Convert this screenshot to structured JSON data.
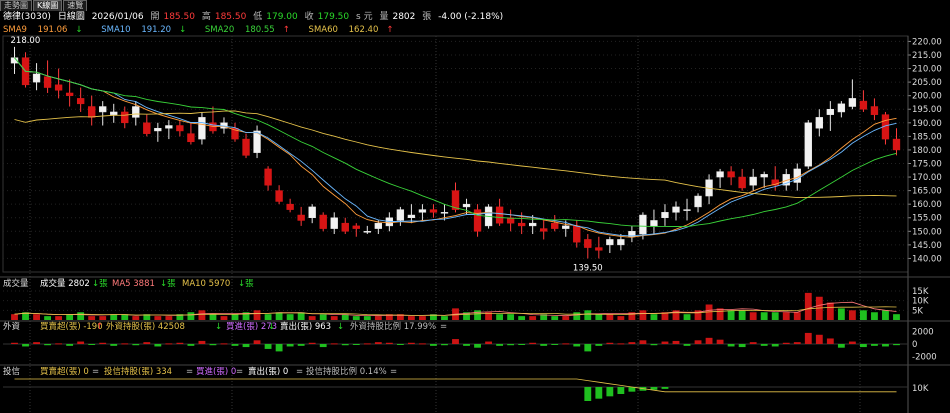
{
  "tabs": [
    "走勢圖",
    "K線圖",
    "速覽"
  ],
  "active_tab": 1,
  "header": {
    "stock": "德律(3030)",
    "period": "日線圖",
    "date": "2026/01/06",
    "open_label": "開",
    "open": "185.50",
    "high_label": "高",
    "high": "185.50",
    "low_label": "低",
    "low": "179.00",
    "close_label": "收",
    "close": "179.50",
    "unit": "s 元",
    "volume_label": "量",
    "volume": "2802",
    "volume_unit": "張",
    "change": "-4.00 (-2.18%)"
  },
  "sma": [
    {
      "label": "SMA9",
      "value": "191.06",
      "arrow": "↓",
      "color": "#ff9e3d"
    },
    {
      "label": "SMA10",
      "value": "191.20",
      "arrow": "↓",
      "color": "#6ab8ff"
    },
    {
      "label": "SMA20",
      "value": "180.55",
      "arrow": "↑",
      "color": "#39d339"
    },
    {
      "label": "SMA60",
      "value": "162.40",
      "arrow": "↑",
      "color": "#e5c24a"
    }
  ],
  "price_axis": {
    "ticks": [
      "220.00",
      "215.00",
      "210.00",
      "205.00",
      "200.00",
      "195.00",
      "190.00",
      "185.00",
      "180.00",
      "175.00",
      "170.00",
      "165.00",
      "160.00",
      "155.00",
      "150.00",
      "145.00",
      "140.00"
    ],
    "high_mark": "218.00",
    "low_mark": "139.50"
  },
  "volume_panel": {
    "title": "成交量",
    "label": "成交量",
    "value": "2802",
    "arrow": "↓",
    "unit": "張",
    "ma5_label": "MA5",
    "ma5": "3881",
    "ma5_arrow": "↓",
    "ma5_unit": "張",
    "ma10_label": "MA10",
    "ma10": "5970",
    "ma10_arrow": "↓",
    "ma10_unit": "張",
    "axis": [
      "15K",
      "10K",
      "5K"
    ]
  },
  "foreign_panel": {
    "title": "外資",
    "net_label": "買賣超(張)",
    "net": "-190",
    "net_arrow": "↑",
    "hold_label": "外資持股(張)",
    "hold": "42508",
    "hold_arrow": "↓",
    "buy_label": "買進(張)",
    "buy": "273",
    "buy_arrow": "↓",
    "sell_label": "賣出(張)",
    "sell": "963",
    "sell_arrow": "↓",
    "ratio_label": "外資持股比例",
    "ratio": "17.99%",
    "ratio_arrow": "=",
    "axis": [
      "2000",
      "0",
      "-2000"
    ]
  },
  "trust_panel": {
    "title": "投信",
    "net_label": "買賣超(張)",
    "net": "0",
    "net_arrow": "=",
    "hold_label": "投信持股(張)",
    "hold": "334",
    "hold_arrow": "=",
    "buy_label": "買進(張)",
    "buy": "0",
    "buy_arrow": "=",
    "sell_label": "賣出(張)",
    "sell": "0",
    "sell_arrow": "=",
    "ratio_label": "投信持股比例",
    "ratio": "0.14%",
    "ratio_arrow": "=",
    "axis": [
      "10K"
    ]
  },
  "chart_data": {
    "type": "candlestick",
    "ylim": [
      135,
      222
    ],
    "candles": [
      [
        212,
        218,
        208,
        214
      ],
      [
        214,
        216,
        203,
        204
      ],
      [
        205,
        212,
        202,
        208
      ],
      [
        207,
        213,
        201,
        203
      ],
      [
        204,
        210,
        199,
        202
      ],
      [
        201,
        206,
        196,
        200
      ],
      [
        199,
        203,
        194,
        197
      ],
      [
        196,
        200,
        189,
        192
      ],
      [
        194,
        198,
        189,
        196
      ],
      [
        193,
        197,
        190,
        194
      ],
      [
        194,
        196,
        188,
        190
      ],
      [
        192,
        198,
        189,
        196
      ],
      [
        190,
        193,
        185,
        186
      ],
      [
        187,
        190,
        183,
        188
      ],
      [
        188,
        191,
        184,
        189
      ],
      [
        189,
        191,
        185,
        187
      ],
      [
        186,
        190,
        182,
        183
      ],
      [
        184,
        194,
        182,
        192
      ],
      [
        190,
        196,
        186,
        187
      ],
      [
        188,
        192,
        186,
        190
      ],
      [
        188,
        190,
        183,
        184
      ],
      [
        184,
        186,
        177,
        178
      ],
      [
        179,
        189,
        177,
        187
      ],
      [
        173,
        174,
        165,
        167
      ],
      [
        165,
        167,
        160,
        161
      ],
      [
        160,
        162,
        157,
        158
      ],
      [
        156,
        159,
        152,
        154
      ],
      [
        155,
        160,
        153,
        159
      ],
      [
        156,
        157,
        150,
        151
      ],
      [
        151,
        157,
        149,
        155
      ],
      [
        153,
        155,
        149,
        150
      ],
      [
        152,
        153,
        148,
        151
      ],
      [
        150,
        152,
        149,
        150
      ],
      [
        151,
        154,
        149,
        153
      ],
      [
        152,
        157,
        150,
        155
      ],
      [
        154,
        159,
        152,
        158
      ],
      [
        155,
        160,
        153,
        156
      ],
      [
        157,
        160,
        154,
        158
      ],
      [
        158,
        160,
        155,
        157
      ],
      [
        157,
        160,
        154,
        157
      ],
      [
        165,
        168,
        157,
        158
      ],
      [
        159,
        162,
        156,
        160
      ],
      [
        158,
        160,
        148,
        150
      ],
      [
        152,
        160,
        151,
        159
      ],
      [
        159,
        162,
        152,
        153
      ],
      [
        155,
        158,
        150,
        153
      ],
      [
        153,
        157,
        149,
        152
      ],
      [
        152,
        156,
        149,
        153
      ],
      [
        151,
        154,
        147,
        150
      ],
      [
        153,
        156,
        150,
        151
      ],
      [
        151,
        154,
        148,
        152
      ],
      [
        152,
        154,
        144,
        146
      ],
      [
        147,
        149,
        140,
        144
      ],
      [
        144,
        148,
        140,
        143
      ],
      [
        145,
        148,
        142,
        147
      ],
      [
        145,
        149,
        143,
        147
      ],
      [
        148,
        152,
        146,
        150
      ],
      [
        149,
        157,
        147,
        156
      ],
      [
        152,
        158,
        149,
        154
      ],
      [
        155,
        160,
        152,
        157
      ],
      [
        157,
        161,
        154,
        159
      ],
      [
        158,
        162,
        154,
        158
      ],
      [
        159,
        164,
        157,
        163
      ],
      [
        163,
        171,
        160,
        169
      ],
      [
        170,
        173,
        166,
        172
      ],
      [
        172,
        174,
        167,
        170
      ],
      [
        170,
        173,
        165,
        166
      ],
      [
        167,
        173,
        165,
        170
      ],
      [
        170,
        172,
        166,
        171
      ],
      [
        169,
        174,
        165,
        167
      ],
      [
        167,
        173,
        165,
        171
      ],
      [
        168,
        175,
        165,
        173
      ],
      [
        174,
        191,
        173,
        190
      ],
      [
        188,
        195,
        185,
        192
      ],
      [
        193,
        198,
        187,
        195
      ],
      [
        194,
        198,
        192,
        197
      ],
      [
        196,
        206,
        195,
        199
      ],
      [
        198,
        202,
        194,
        195
      ],
      [
        196,
        199,
        191,
        193
      ],
      [
        193,
        194,
        182,
        184
      ],
      [
        184,
        188,
        178,
        180
      ]
    ],
    "volume": [
      [
        3,
        0
      ],
      [
        4,
        1
      ],
      [
        3,
        0
      ],
      [
        2,
        1
      ],
      [
        2,
        0
      ],
      [
        3,
        1
      ],
      [
        4,
        1
      ],
      [
        2,
        0
      ],
      [
        2,
        0
      ],
      [
        3,
        1
      ],
      [
        3,
        1
      ],
      [
        2,
        0
      ],
      [
        3,
        1
      ],
      [
        2,
        0
      ],
      [
        2,
        0
      ],
      [
        3,
        1
      ],
      [
        4,
        1
      ],
      [
        5,
        0
      ],
      [
        3,
        1
      ],
      [
        2,
        0
      ],
      [
        3,
        1
      ],
      [
        4,
        1
      ],
      [
        5,
        0
      ],
      [
        3,
        1
      ],
      [
        4,
        1
      ],
      [
        3,
        1
      ],
      [
        4,
        1
      ],
      [
        2,
        0
      ],
      [
        3,
        1
      ],
      [
        2,
        0
      ],
      [
        3,
        1
      ],
      [
        2,
        1
      ],
      [
        2,
        1
      ],
      [
        2,
        0
      ],
      [
        3,
        0
      ],
      [
        3,
        0
      ],
      [
        2,
        0
      ],
      [
        2,
        0
      ],
      [
        3,
        1
      ],
      [
        2,
        1
      ],
      [
        6,
        0
      ],
      [
        4,
        1
      ],
      [
        5,
        1
      ],
      [
        4,
        0
      ],
      [
        3,
        1
      ],
      [
        3,
        1
      ],
      [
        2,
        1
      ],
      [
        2,
        0
      ],
      [
        3,
        1
      ],
      [
        2,
        1
      ],
      [
        2,
        0
      ],
      [
        4,
        1
      ],
      [
        5,
        1
      ],
      [
        3,
        1
      ],
      [
        3,
        0
      ],
      [
        2,
        0
      ],
      [
        4,
        0
      ],
      [
        5,
        0
      ],
      [
        3,
        1
      ],
      [
        4,
        0
      ],
      [
        5,
        0
      ],
      [
        3,
        1
      ],
      [
        5,
        0
      ],
      [
        8,
        0
      ],
      [
        6,
        0
      ],
      [
        5,
        1
      ],
      [
        5,
        1
      ],
      [
        4,
        0
      ],
      [
        4,
        1
      ],
      [
        4,
        1
      ],
      [
        4,
        0
      ],
      [
        4,
        0
      ],
      [
        14,
        0
      ],
      [
        12,
        0
      ],
      [
        9,
        0
      ],
      [
        6,
        1
      ],
      [
        5,
        0
      ],
      [
        5,
        1
      ],
      [
        4,
        1
      ],
      [
        5,
        1
      ],
      [
        3,
        1
      ]
    ],
    "foreign_net": [
      200,
      -400,
      300,
      -200,
      100,
      -300,
      400,
      -100,
      200,
      -300,
      100,
      -200,
      300,
      -400,
      100,
      200,
      -300,
      500,
      -200,
      100,
      -300,
      -500,
      600,
      -800,
      -1200,
      -400,
      -300,
      200,
      -500,
      100,
      -200,
      -100,
      100,
      300,
      200,
      -100,
      200,
      100,
      -300,
      -200,
      800,
      -300,
      -600,
      400,
      -300,
      -200,
      -100,
      200,
      -300,
      -100,
      100,
      -400,
      -1200,
      -300,
      200,
      100,
      300,
      600,
      -200,
      400,
      500,
      -300,
      600,
      1000,
      700,
      -400,
      -500,
      300,
      -300,
      -400,
      200,
      300,
      1800,
      1500,
      900,
      -600,
      400,
      -500,
      -300,
      -400,
      -190
    ],
    "trust_net": [
      0,
      0,
      0,
      0,
      0,
      0,
      0,
      0,
      0,
      0,
      0,
      0,
      0,
      0,
      0,
      0,
      0,
      0,
      0,
      0,
      0,
      0,
      0,
      0,
      0,
      0,
      0,
      0,
      0,
      0,
      0,
      0,
      0,
      0,
      0,
      0,
      0,
      0,
      0,
      0,
      0,
      0,
      0,
      0,
      0,
      0,
      0,
      0,
      0,
      0,
      0,
      0,
      -3000,
      -2500,
      -2000,
      -1500,
      -1000,
      -800,
      -600,
      -400,
      0,
      0,
      0,
      0,
      0,
      0,
      0,
      0,
      0,
      0,
      0,
      0,
      0,
      0,
      0,
      0,
      0,
      0,
      0,
      0,
      0
    ]
  }
}
